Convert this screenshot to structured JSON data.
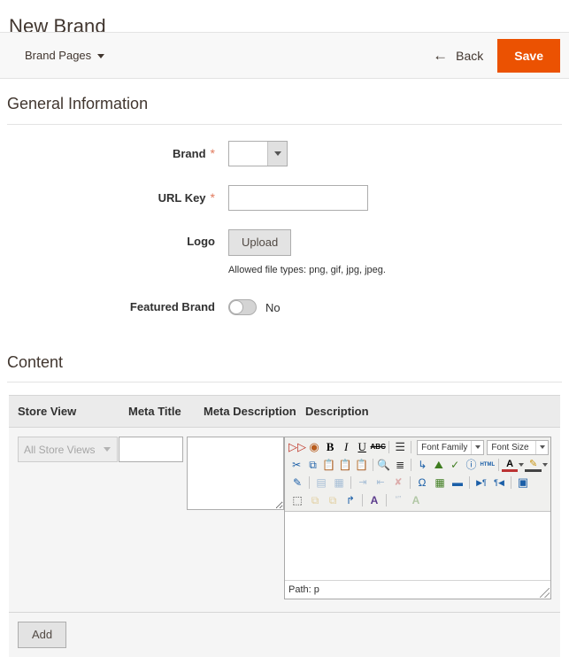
{
  "page": {
    "title": "New Brand"
  },
  "page_actions": {
    "store_switcher_label": "Brand Pages",
    "back_label": "Back",
    "back_icon": "arrow-left-icon",
    "save_label": "Save",
    "accent_color": "#eb5202"
  },
  "general_information": {
    "section_title": "General Information",
    "fields": {
      "brand": {
        "label": "Brand",
        "required_marker": "*",
        "value": "",
        "options": [
          ""
        ]
      },
      "url_key": {
        "label": "URL Key",
        "required_marker": "*",
        "value": "",
        "placeholder": ""
      },
      "logo": {
        "label": "Logo",
        "upload_label": "Upload",
        "note": "Allowed file types: png, gif, jpg, jpeg."
      },
      "featured_brand": {
        "label": "Featured Brand",
        "toggle_state": "No"
      }
    }
  },
  "content_section": {
    "section_title": "Content",
    "table": {
      "headers": {
        "store_view": "Store View",
        "meta_title": "Meta Title",
        "meta_description": "Meta Description",
        "description": "Description"
      },
      "rows": [
        {
          "store_view_value": "All Store Views",
          "store_view_disabled": true,
          "meta_title_value": "",
          "meta_description_value": "",
          "description_value": ""
        }
      ]
    },
    "add_label": "Add"
  },
  "editor": {
    "status_path": "Path: p",
    "font_family_label": "Font Family",
    "font_size_label": "Font Size",
    "toolbar_rows": [
      [
        {
          "icon": "spellcheck-icon",
          "glyph": "ⓢ",
          "label": "Spell Check",
          "disabled": false,
          "color": "#c0392b"
        },
        {
          "icon": "insert-variable-icon",
          "glyph": "◔",
          "label": "Insert Variable",
          "disabled": false,
          "color": "#b85c1d"
        },
        {
          "icon": "bold-icon",
          "glyph": "B",
          "label": "Bold",
          "disabled": false,
          "color": "#000000"
        },
        {
          "icon": "italic-icon",
          "glyph": "I",
          "label": "Italic",
          "disabled": false,
          "color": "#000000"
        },
        {
          "icon": "underline-icon",
          "glyph": "U",
          "label": "Underline",
          "disabled": false,
          "color": "#000000"
        },
        {
          "icon": "strikethrough-icon",
          "glyph": "ABC",
          "label": "Strikethrough",
          "disabled": false,
          "color": "#000000"
        },
        {
          "sep": true
        },
        {
          "icon": "justify-icon",
          "glyph": "☰",
          "label": "Justify",
          "disabled": false,
          "color": "#333333"
        },
        {
          "sep": true
        }
      ],
      [
        {
          "icon": "cut-icon",
          "glyph": "✂",
          "label": "Cut",
          "disabled": false,
          "color": "#1b5fa8"
        },
        {
          "icon": "copy-icon",
          "glyph": "⧉",
          "label": "Copy",
          "disabled": false,
          "color": "#1b5fa8"
        },
        {
          "icon": "paste-icon",
          "glyph": "ὌB",
          "label": "Paste",
          "disabled": false,
          "color": "#c8920c"
        },
        {
          "icon": "paste-text-icon",
          "glyph": "ὌB",
          "label": "Paste as Text",
          "disabled": false,
          "color": "#c8920c"
        },
        {
          "icon": "paste-word-icon",
          "glyph": "ὌB",
          "label": "Paste from Word",
          "disabled": false,
          "color": "#c8920c"
        },
        {
          "sep": true
        },
        {
          "icon": "find-replace-icon",
          "glyph": "ὐD",
          "label": "Find and Replace",
          "disabled": false,
          "color": "#1b5fa8"
        },
        {
          "icon": "list-icon",
          "glyph": "≣",
          "label": "Lists",
          "disabled": false,
          "color": "#333333"
        },
        {
          "sep": true
        },
        {
          "icon": "indent-icon",
          "glyph": "↳",
          "label": "Indent",
          "disabled": false,
          "color": "#1b5fa8"
        },
        {
          "icon": "insert-image-icon",
          "glyph": "⛰",
          "label": "Insert Image",
          "disabled": false,
          "color": "#3f7d20"
        },
        {
          "icon": "cleanup-icon",
          "glyph": "ᾟ9",
          "label": "Cleanup Messy Code",
          "disabled": false,
          "color": "#3f7d20"
        },
        {
          "icon": "help-icon",
          "glyph": "?",
          "label": "Help",
          "disabled": false,
          "color": "#1b5fa8"
        },
        {
          "icon": "html-source-icon",
          "glyph": "HTML",
          "label": "Edit HTML Source",
          "disabled": false,
          "color": "#1b5fa8"
        },
        {
          "sep": true
        },
        {
          "icon": "text-color-icon",
          "glyph": "A",
          "label": "Text Color",
          "disabled": false,
          "color": "#000000"
        },
        {
          "icon": "background-color-icon",
          "glyph": "✎",
          "label": "Background Color",
          "disabled": false,
          "color": "#c8920c"
        }
      ],
      [
        {
          "icon": "insert-edit-icon",
          "glyph": "✍",
          "label": "Insert/Edit",
          "disabled": false,
          "color": "#1b5fa8"
        },
        {
          "sep": true
        },
        {
          "icon": "table-row-icon",
          "glyph": "▤",
          "label": "Table Row",
          "disabled": true,
          "color": "#8fa4bb"
        },
        {
          "icon": "table-cell-icon",
          "glyph": "▦",
          "label": "Table Cell",
          "disabled": true,
          "color": "#8fa4bb"
        },
        {
          "sep": true
        },
        {
          "icon": "insert-row-before-icon",
          "glyph": "⭱",
          "label": "Insert Row Before",
          "disabled": true,
          "color": "#8fa4bb"
        },
        {
          "icon": "insert-row-after-icon",
          "glyph": "⭳",
          "label": "Insert Row After",
          "disabled": true,
          "color": "#8fa4bb"
        },
        {
          "icon": "delete-row-icon",
          "glyph": "✘",
          "label": "Delete Row",
          "disabled": true,
          "color": "#c48a8a"
        },
        {
          "sep": true
        },
        {
          "icon": "special-character-icon",
          "glyph": "Ω",
          "label": "Insert Special Character",
          "disabled": false,
          "color": "#1b5fa8"
        },
        {
          "icon": "insert-media-icon",
          "glyph": "ἹE",
          "label": "Insert Media",
          "disabled": false,
          "color": "#3f7d20"
        },
        {
          "icon": "horizontal-rule-icon",
          "glyph": "▬",
          "label": "Insert Horizontal Rule",
          "disabled": false,
          "color": "#1b5fa8"
        },
        {
          "sep": true
        },
        {
          "icon": "ltr-icon",
          "glyph": "▶¶",
          "label": "Left to Right",
          "disabled": false,
          "color": "#1b5fa8"
        },
        {
          "icon": "rtl-icon",
          "glyph": "¶◀",
          "label": "Right to Left",
          "disabled": false,
          "color": "#1b5fa8"
        },
        {
          "sep": true
        },
        {
          "icon": "fullscreen-icon",
          "glyph": "▣",
          "label": "Fullscreen",
          "disabled": false,
          "color": "#1b5fa8"
        }
      ],
      [
        {
          "icon": "visual-aid-icon",
          "glyph": "⬚",
          "label": "Show/Hide Guidelines",
          "disabled": false,
          "color": "#333333"
        },
        {
          "icon": "move-forward-icon",
          "glyph": "⧉",
          "label": "Move Forward",
          "disabled": true,
          "color": "#c8920c"
        },
        {
          "icon": "move-backward-icon",
          "glyph": "⧉",
          "label": "Move Backward",
          "disabled": true,
          "color": "#c8920c"
        },
        {
          "icon": "absolute-position-icon",
          "glyph": "↱",
          "label": "Toggle Absolute Positioning",
          "disabled": false,
          "color": "#1b5fa8"
        },
        {
          "sep": true
        },
        {
          "icon": "styles-icon",
          "glyph": "A",
          "label": "Styles",
          "disabled": false,
          "color": "#5b3b8c"
        },
        {
          "sep": true
        },
        {
          "icon": "blockquote-icon",
          "glyph": "“”",
          "label": "Blockquote",
          "disabled": true,
          "color": "#9fb0c4"
        },
        {
          "icon": "remove-format-icon",
          "glyph": "A",
          "label": "Remove Formatting",
          "disabled": true,
          "color": "#9fc49f"
        }
      ]
    ]
  }
}
